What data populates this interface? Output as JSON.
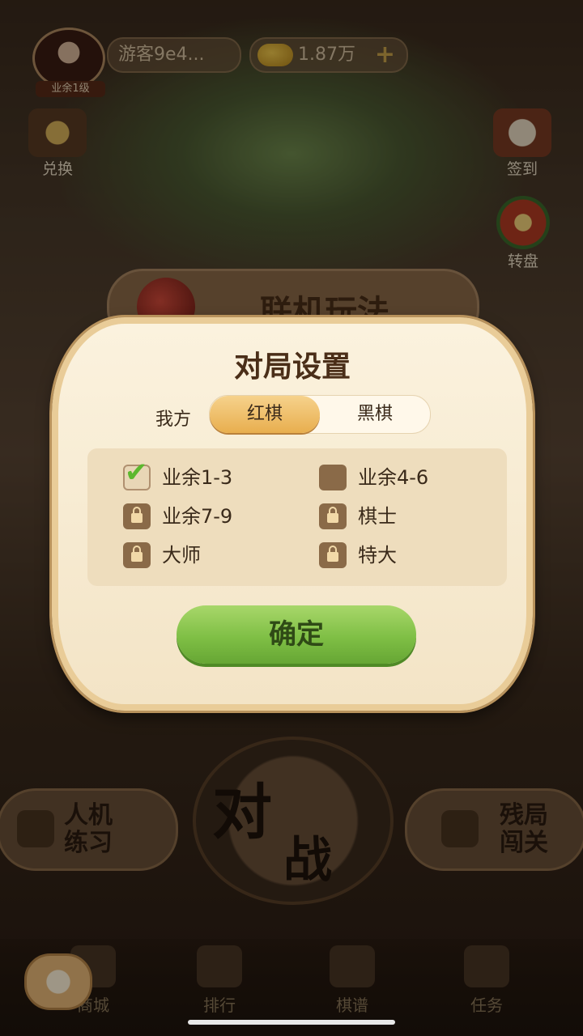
{
  "header": {
    "avatar_level": "业余1级",
    "username": "游客9e4...",
    "coins": "1.87万"
  },
  "side_buttons": {
    "exchange": "兑换",
    "checkin": "签到",
    "wheel": "转盘"
  },
  "online_banner": "联机玩法",
  "modal": {
    "title": "对局设置",
    "side_label": "我方",
    "sides": [
      "红棋",
      "黑棋"
    ],
    "selected_side": "红棋",
    "levels": [
      {
        "label": "业余1-3",
        "state": "checked"
      },
      {
        "label": "业余4-6",
        "state": "unchecked"
      },
      {
        "label": "业余7-9",
        "state": "locked"
      },
      {
        "label": "棋士",
        "state": "locked"
      },
      {
        "label": "大师",
        "state": "locked"
      },
      {
        "label": "特大",
        "state": "locked"
      }
    ],
    "confirm": "确定"
  },
  "main_modes": {
    "battle_char1": "对",
    "battle_char2": "战",
    "ai_practice": "人机练习",
    "endgame": "残局闯关"
  },
  "bottom_nav": {
    "shop": "商城",
    "rank": "排行",
    "book": "棋谱",
    "task": "任务"
  }
}
